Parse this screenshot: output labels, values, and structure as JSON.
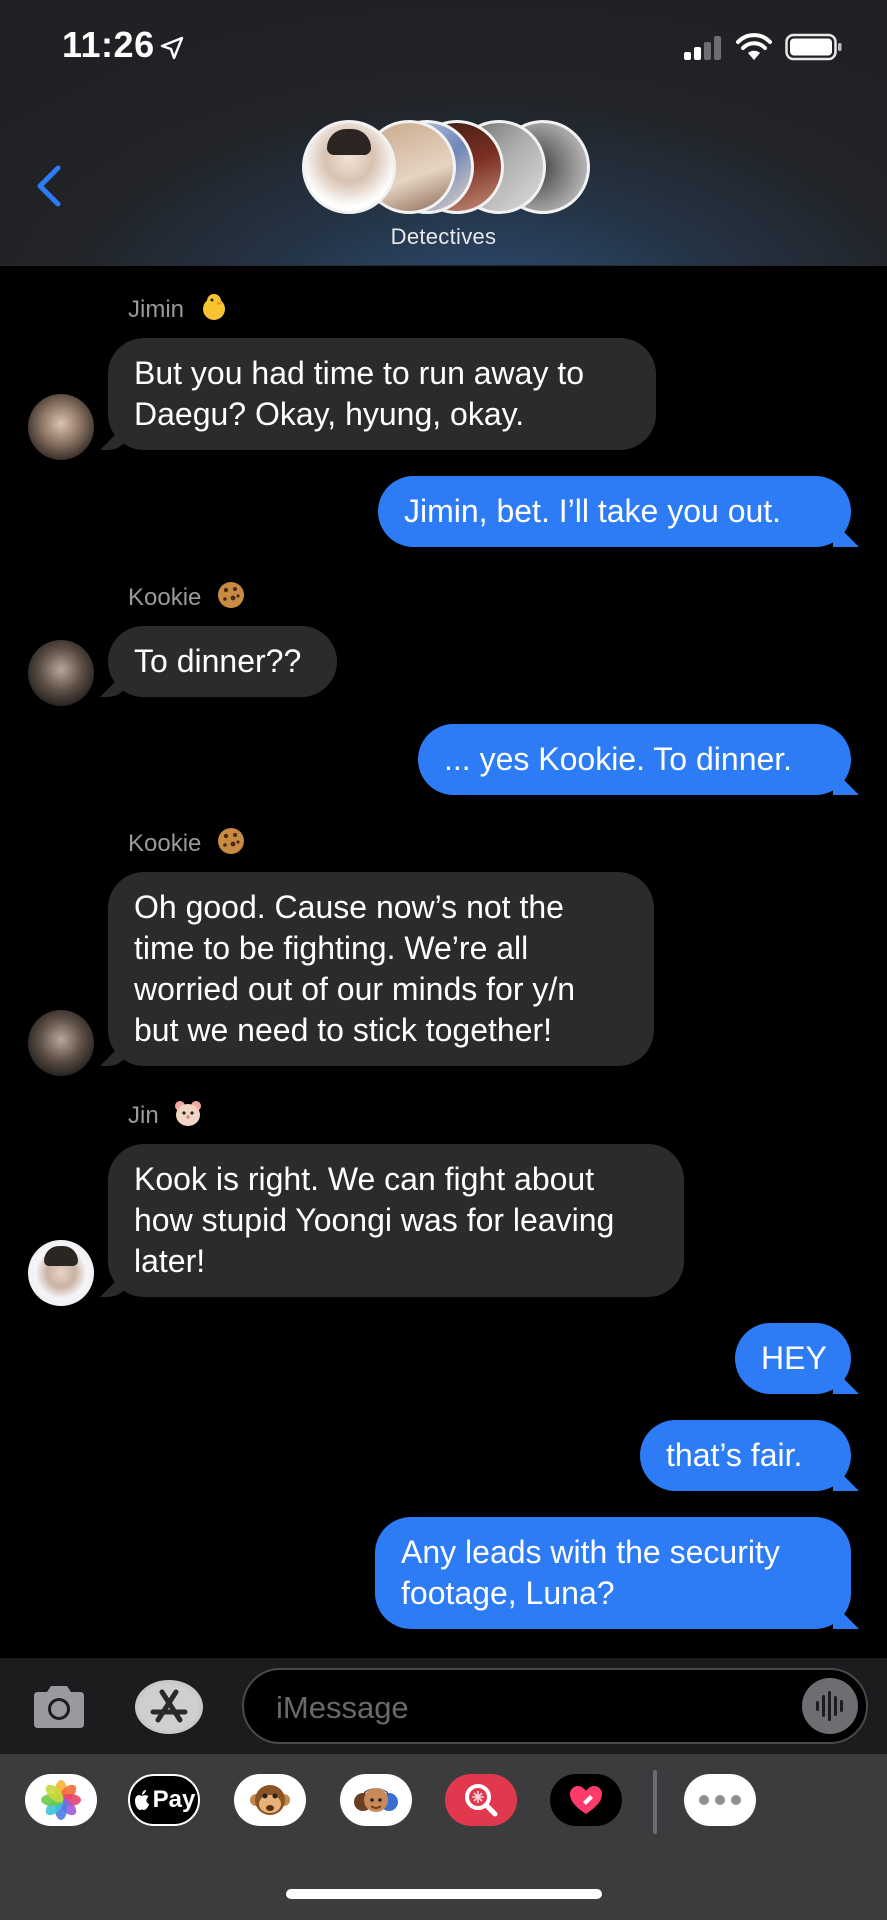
{
  "status_bar": {
    "time": "11:26"
  },
  "header": {
    "group_name": "Detectives"
  },
  "messages": [
    {
      "sender": "Jimin",
      "sender_emoji": "chick-emoji",
      "direction": "received",
      "text": [
        "But you had time to run away to",
        "Daegu? Okay, hyung, okay."
      ]
    },
    {
      "direction": "sent",
      "text": [
        "Jimin, bet. I’ll take you out."
      ]
    },
    {
      "sender": "Kookie",
      "sender_emoji": "cookie-emoji",
      "direction": "received",
      "text": [
        "To dinner??"
      ]
    },
    {
      "direction": "sent",
      "text": [
        "... yes Kookie. To dinner."
      ]
    },
    {
      "sender": "Kookie",
      "sender_emoji": "cookie-emoji",
      "direction": "received",
      "text": [
        "Oh good. Cause now’s not the",
        "time to be fighting. We’re all",
        "worried out of our minds for y/n",
        "but we need to stick together!"
      ]
    },
    {
      "sender": "Jin",
      "sender_emoji": "hamster-emoji",
      "direction": "received",
      "text": [
        "Kook is right. We can fight about",
        "how stupid Yoongi was for leaving",
        "later!"
      ]
    },
    {
      "direction": "sent",
      "text": [
        "HEY"
      ]
    },
    {
      "direction": "sent",
      "text": [
        "that’s fair."
      ]
    },
    {
      "direction": "sent",
      "text": [
        "Any leads with the security",
        "footage, Luna?"
      ]
    }
  ],
  "input": {
    "placeholder": "iMessage"
  },
  "app_drawer": {
    "apps": [
      "photos-app",
      "apple-pay-app",
      "animoji-app",
      "memoji-app",
      "image-search-app",
      "digital-touch-app",
      "more-apps"
    ],
    "apple_pay_label": "Pay"
  },
  "colors": {
    "sent_bubble": "#2d7cf6",
    "received_bubble": "#2b2b2d",
    "accent": "#2d7cf6"
  }
}
